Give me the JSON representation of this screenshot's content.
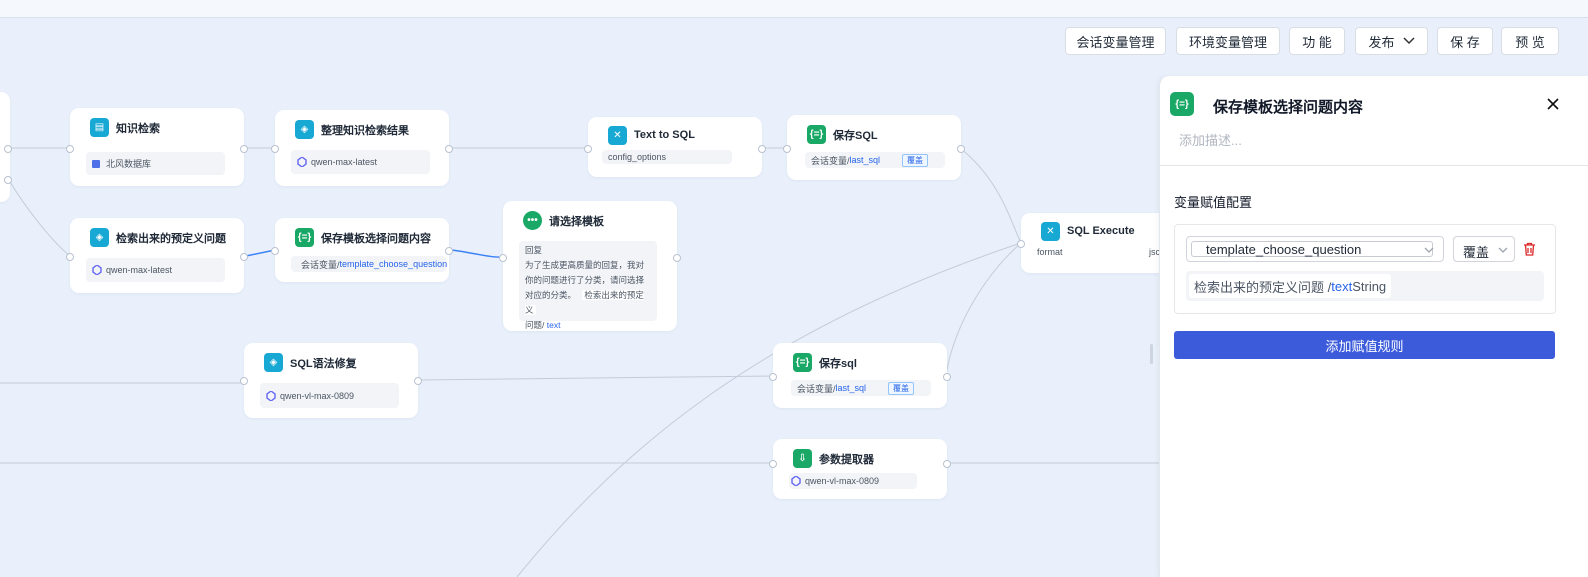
{
  "toolbar": {
    "session_vars": "会话变量管理",
    "env_vars": "环境变量管理",
    "features": "功 能",
    "publish": "发布",
    "save": "保 存",
    "preview": "预 览"
  },
  "nodes": {
    "knowledge_search": {
      "title": "知识检索",
      "sub": "北风数据库"
    },
    "organize_results": {
      "title": "整理知识检索结果",
      "sub": "qwen-max-latest"
    },
    "text_to_sql": {
      "title": "Text to SQL",
      "sub": "config_options"
    },
    "save_sql_upper": {
      "title": "保存SQL",
      "sub_prefix": "会话变量/ ",
      "sub_var": "last_sql",
      "tag": "覆盖"
    },
    "predefined_question": {
      "title": "检索出来的预定义问题",
      "sub": "qwen-max-latest"
    },
    "save_template_choice": {
      "title": "保存模板选择问题内容",
      "sub_prefix": "会话变量/ ",
      "sub_var": "template_choose_question"
    },
    "choose_template": {
      "title": "请选择模板",
      "line1": "回复",
      "line2": "为了生成更高质量的回复，我对",
      "line3": "你的问题进行了分类，请问选择",
      "line4": "对应的分类。",
      "chip": "检索出来的预定义",
      "line5_prefix": "问题/ ",
      "line5_var": "text"
    },
    "sql_execute": {
      "title": "SQL Execute",
      "sub": "format",
      "sub_right": "jsc"
    },
    "sql_fix": {
      "title": "SQL语法修复",
      "sub": "qwen-vl-max-0809"
    },
    "save_sql_lower": {
      "title": "保存sql",
      "sub_prefix": "会话变量/ ",
      "sub_var": "last_sql",
      "tag": "覆盖"
    },
    "param_extractor": {
      "title": "参数提取器",
      "sub": "qwen-vl-max-0809"
    }
  },
  "panel": {
    "title": "保存模板选择问题内容",
    "desc_placeholder": "添加描述...",
    "section_title": "变量赋值配置",
    "var_select": "template_choose_question",
    "mode_select": "覆盖",
    "value_prefix": "检索出来的预定义问题 / ",
    "value_var": "text",
    "value_type": " String",
    "add_rule": "添加赋值规则"
  },
  "colors": {
    "canvas": "#e9f0fb",
    "accent": "#3b5bdb",
    "node_cyan": "#17a8d3",
    "node_green": "#19a865",
    "link": "#2563eb",
    "danger": "#dc2626"
  }
}
